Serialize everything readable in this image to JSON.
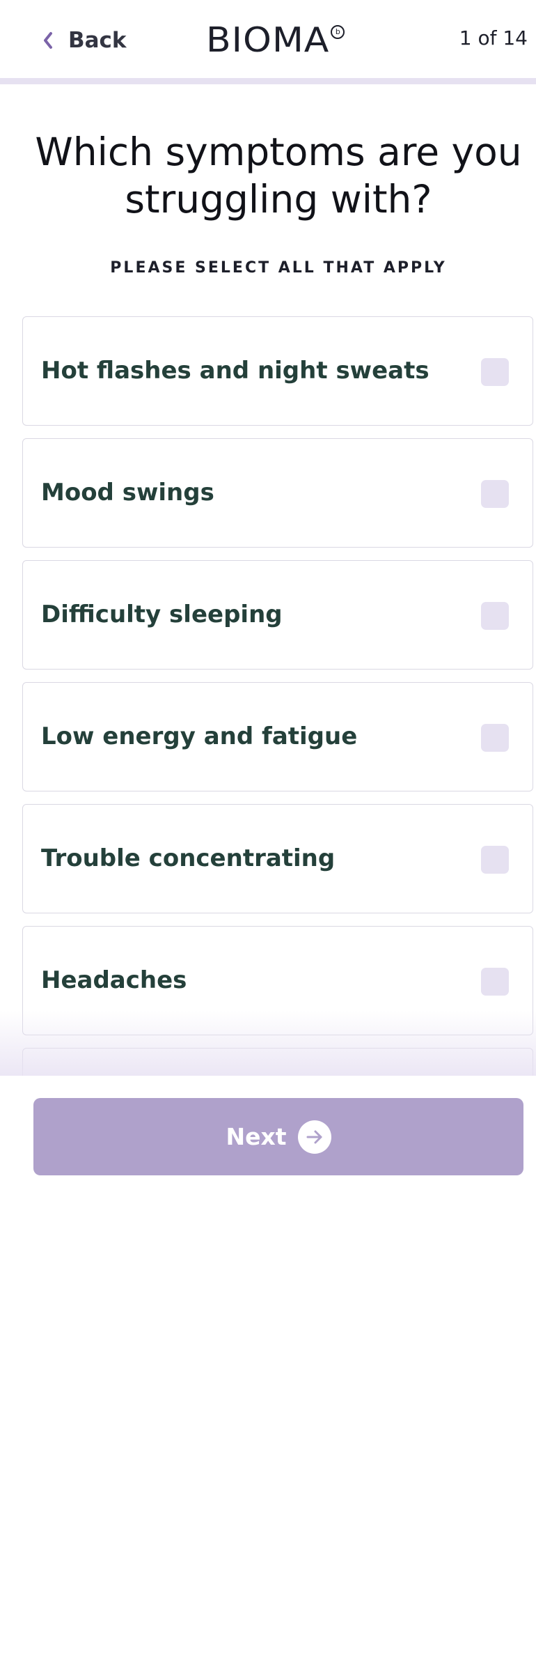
{
  "header": {
    "back_label": "Back",
    "logo_text": "BIOMA",
    "logo_mark": "b",
    "step_counter": "1 of 14"
  },
  "question": {
    "title": "Which symptoms are you struggling with?",
    "subtitle": "PLEASE SELECT ALL THAT APPLY"
  },
  "options": [
    {
      "label": "Hot flashes and night sweats",
      "checked": false
    },
    {
      "label": "Mood swings",
      "checked": false
    },
    {
      "label": "Difficulty sleeping",
      "checked": false
    },
    {
      "label": "Low energy and fatigue",
      "checked": false
    },
    {
      "label": "Trouble concentrating",
      "checked": false
    },
    {
      "label": "Headaches",
      "checked": false
    }
  ],
  "footer": {
    "next_label": "Next"
  },
  "icons": {
    "back": "chevron-left-icon",
    "next": "arrow-right-icon"
  },
  "colors": {
    "accent": "#7b63a8",
    "button": "#afa1cb",
    "checkbox": "#e6e1f1",
    "option_text": "#24403a"
  }
}
